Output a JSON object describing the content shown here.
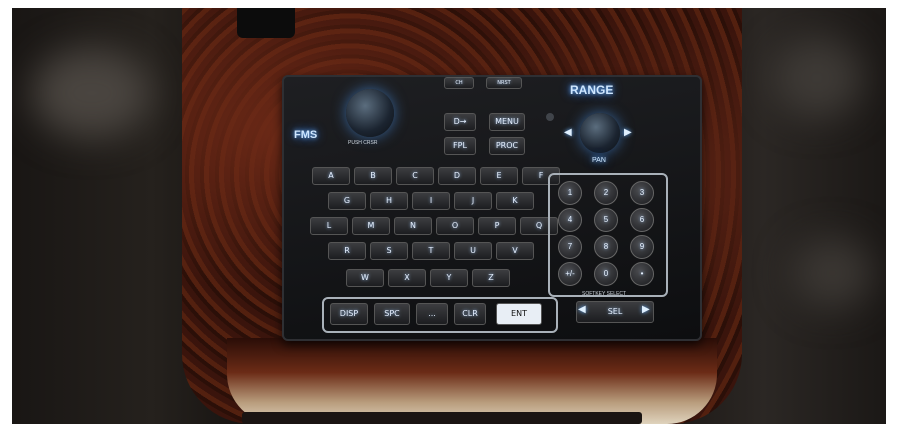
{
  "panel": {
    "fms_label": "FMS",
    "push_label": "PUSH CRSR",
    "top_keys": [
      "CH",
      "NRST"
    ],
    "direct_label": "D→",
    "menu_label": "MENU",
    "fpl_label": "FPL",
    "proc_label": "PROC",
    "range_label": "RANGE",
    "pan_label": "PAN",
    "letters_row1": [
      "A",
      "B",
      "C",
      "D",
      "E",
      "F"
    ],
    "letters_row2": [
      "G",
      "H",
      "I",
      "J",
      "K"
    ],
    "letters_row3": [
      "L",
      "M",
      "N",
      "O",
      "P",
      "Q"
    ],
    "letters_row4": [
      "R",
      "S",
      "T",
      "U",
      "V"
    ],
    "letters_row5": [
      "W",
      "X",
      "Y",
      "Z"
    ],
    "numpad": [
      "1",
      "2",
      "3",
      "4",
      "5",
      "6",
      "7",
      "8",
      "9",
      "+/-",
      "0",
      "•"
    ],
    "bottom_keys": [
      "DISP",
      "SPC",
      "CLR",
      "ENT"
    ],
    "bottom_combo_label": "...",
    "softkey_select_label": "SOFTKEY SELECT",
    "sel_label": "SEL"
  },
  "colors": {
    "backlight": "#6fb4ff",
    "wood": "#5a2210",
    "panel": "#141518"
  }
}
